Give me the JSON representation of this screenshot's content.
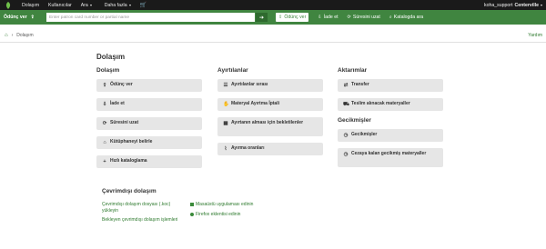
{
  "topnav": {
    "items": [
      "Dolaşım",
      "Kullanıcılar",
      "Ara",
      "Daha fazla"
    ],
    "user": "koha_support",
    "branch": "Centerville"
  },
  "searchbar": {
    "checkout_label": "Ödünç ver",
    "placeholder": "Enter patron card number or partial name",
    "links": [
      "Ödünç ver",
      "İade et",
      "Süresini uzat",
      "Katalogda ara"
    ]
  },
  "breadcrumb": {
    "current": "Dolaşım",
    "help": "Yardım"
  },
  "page_title": "Dolaşım",
  "columns": [
    {
      "title": "Dolaşım",
      "buttons": [
        "Ödünç ver",
        "İade et",
        "Süresini uzat",
        "Kütüphaneyi belirle",
        "Hızlı kataloglama"
      ]
    },
    {
      "title": "Ayırtılanlar",
      "buttons": [
        "Ayırtılanlar sırası",
        "Materyal Ayırtma İptali",
        "Ayırtanın alması için bekletilenler",
        "Ayırma oranları"
      ]
    },
    {
      "title": "Aktarımlar",
      "buttons": [
        "Transfer",
        "Teslim alınacak materyaller"
      ]
    },
    {
      "title": "Gecikmişler",
      "buttons": [
        "Gecikmişler",
        "Cezaya kalan gecikmiş materyaller"
      ]
    }
  ],
  "offline": {
    "title": "Çevrimdışı dolaşım",
    "left_links": [
      "Çevrimdışı dolaşım dosyası (.koc) yükleyin",
      "Bekleyen çevrimdışı dolaşım işlemleri"
    ],
    "right_links": [
      "Masaüstü uygulaması edinin",
      "Firefox eklentisi edinin"
    ]
  },
  "colors": {
    "brand_green": "#408540",
    "topbar": "#1a1a1a",
    "button_bg": "#e6e6e6",
    "link_green": "#2e7a2e"
  }
}
